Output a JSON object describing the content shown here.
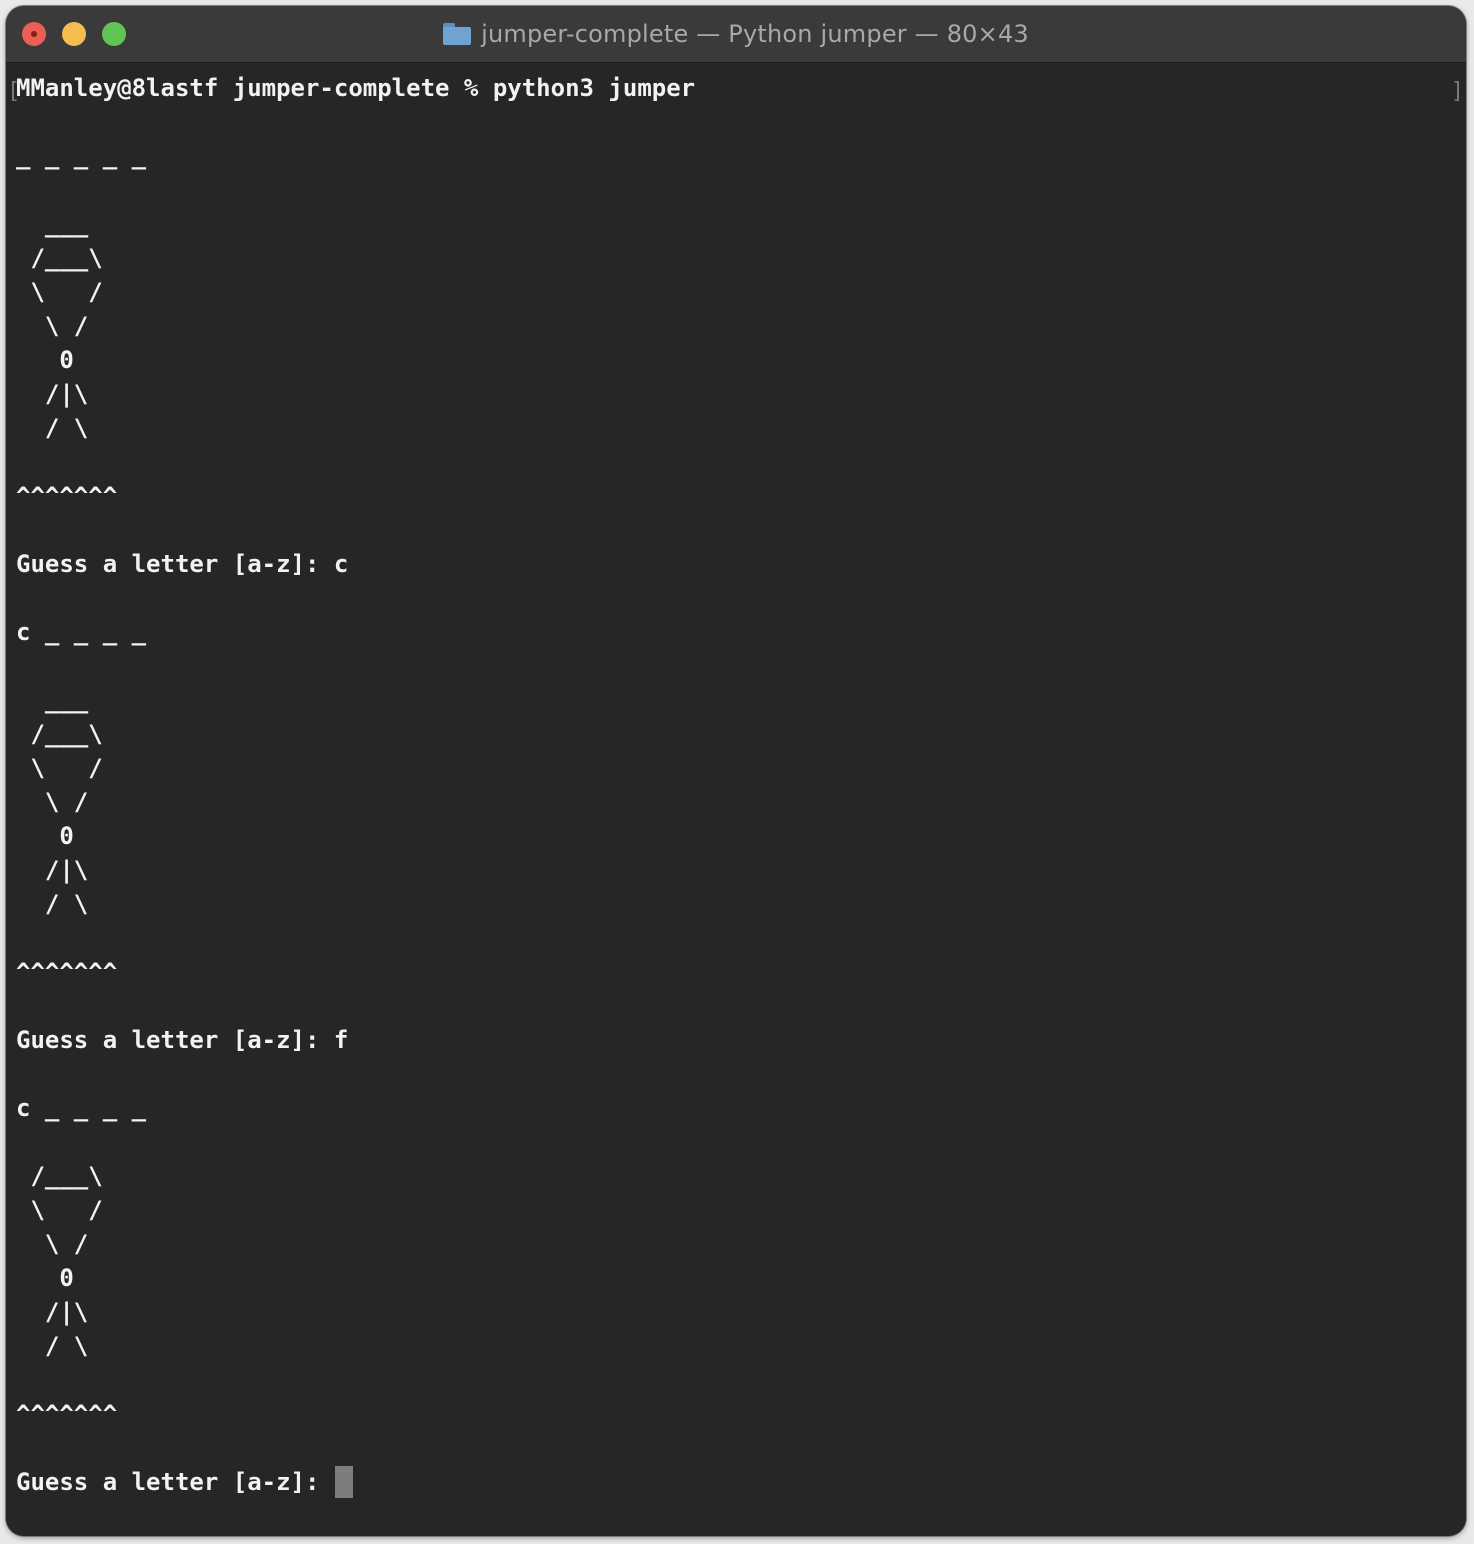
{
  "window": {
    "title": "jumper-complete — Python jumper — 80×43",
    "icon": "folder-icon"
  },
  "terminal": {
    "lines": [
      "MManley@8lastf jumper-complete % python3 jumper",
      "",
      "_ _ _ _ _",
      "",
      "  ___",
      " /___\\",
      " \\   /",
      "  \\ /",
      "   0",
      "  /|\\",
      "  / \\",
      "",
      "^^^^^^^",
      "",
      "Guess a letter [a-z]: c",
      "",
      "c _ _ _ _",
      "",
      "  ___",
      " /___\\",
      " \\   /",
      "  \\ /",
      "   0",
      "  /|\\",
      "  / \\",
      "",
      "^^^^^^^",
      "",
      "Guess a letter [a-z]: f",
      "",
      "c _ _ _ _",
      "",
      " /___\\",
      " \\   /",
      "  \\ /",
      "   0",
      "  /|\\",
      "  / \\",
      "",
      "^^^^^^^",
      "",
      "Guess a letter [a-z]: "
    ]
  }
}
